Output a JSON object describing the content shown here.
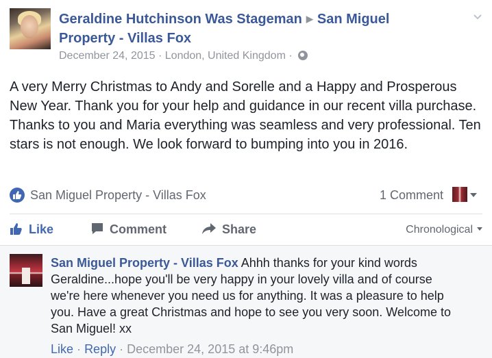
{
  "post": {
    "author": "Geraldine Hutchinson Was Stageman",
    "target_page": "San Miguel Property - Villas Fox",
    "date": "December 24, 2015",
    "separator": "·",
    "location": "London, United Kingdom",
    "audience_icon": "globe-icon",
    "text": "A very Merry Christmas to Andy and Sorelle and a Happy and Prosperous New Year. Thank you for your help and guidance in our recent villa purchase. Thanks to you and Maria everything was seamless and very professional. Ten stars is not enough. We look forward to bumping into you in 2016."
  },
  "reactions": {
    "icon": "like-icon",
    "names": "San Miguel Property - Villas Fox",
    "comment_count": "1 Comment"
  },
  "actions": {
    "like": "Like",
    "comment": "Comment",
    "share": "Share",
    "sort": "Chronological"
  },
  "comment": {
    "author": "San Miguel Property - Villas Fox",
    "text": "Ahhh thanks for your kind words Geraldine...hope you'll be very happy in your lovely villa and of course we're here whenever you need us for anything. It was a pleasure to help you. Have a great Christmas and hope to see you very soon. Welcome to San Miguel! xx",
    "like": "Like",
    "reply": "Reply",
    "dot": "·",
    "timestamp": "December 24, 2015 at 9:46pm"
  },
  "colors": {
    "link": "#3b5998",
    "accent": "#4267b2",
    "muted": "#90949c",
    "comment_bg": "#f6f7f9"
  }
}
